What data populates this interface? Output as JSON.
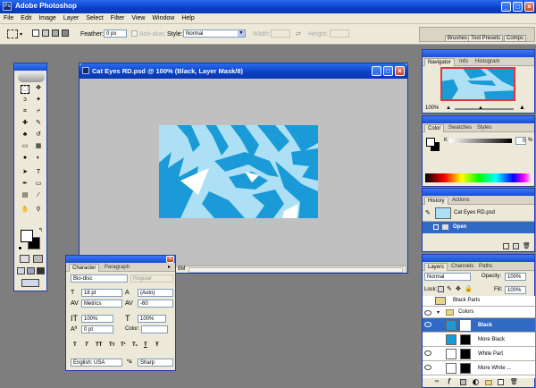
{
  "app": {
    "title": "Adobe Photoshop"
  },
  "menu": [
    "File",
    "Edit",
    "Image",
    "Layer",
    "Select",
    "Filter",
    "View",
    "Window",
    "Help"
  ],
  "options": {
    "feather_label": "Feather:",
    "feather_value": "0 px",
    "antialias": "Anti-alias",
    "style_label": "Style:",
    "style_value": "Normal",
    "width_label": "Width:",
    "height_label": "Height:"
  },
  "well_tabs": [
    "Brushes",
    "Tool Presets",
    "Comps"
  ],
  "document": {
    "title": "Cat Eyes RD.psd @ 100% (Black, Layer Mask/8)",
    "status": "6M"
  },
  "navigator": {
    "tabs": [
      "Navigator",
      "Info",
      "Histogram"
    ],
    "zoom": "100%"
  },
  "color_panel": {
    "tabs": [
      "Color",
      "Swatches",
      "Styles"
    ],
    "channel": "K",
    "value": "0",
    "unit": "%"
  },
  "history": {
    "tabs": [
      "History",
      "Actions"
    ],
    "snapshot": "Cat Eyes RD.psd",
    "state": "Open"
  },
  "layers": {
    "tabs": [
      "Layers",
      "Channels",
      "Paths"
    ],
    "blend": "Normal",
    "opacity_label": "Opacity:",
    "opacity": "100%",
    "lock_label": "Lock:",
    "fill_label": "Fill:",
    "fill": "100%",
    "rows": [
      {
        "name": "Black Parts"
      },
      {
        "name": "Colors"
      },
      {
        "name": "Black"
      },
      {
        "name": "More Black"
      },
      {
        "name": "White Part"
      },
      {
        "name": "More White ..."
      }
    ]
  },
  "character": {
    "tabs": [
      "Character",
      "Paragraph"
    ],
    "font": "Bio-disc",
    "style": "Regular",
    "size": "18 pt",
    "leading": "(Auto)",
    "kerning": "Metrics",
    "tracking": "-60",
    "vscale": "100%",
    "hscale": "100%",
    "baseline": "0 pt",
    "color_label": "Color:",
    "style_buttons": [
      "T",
      "T",
      "TT",
      "Tт",
      "T¹",
      "T₁",
      "T",
      "Ŧ"
    ],
    "language": "English: USA",
    "aa_label": "ªa",
    "aa": "Sharp"
  },
  "colors": {
    "accent": "#0a3fc4",
    "tiger_blue": "#1a9bd7",
    "tiger_light": "#aee0f5",
    "selection": "#316ac5"
  }
}
